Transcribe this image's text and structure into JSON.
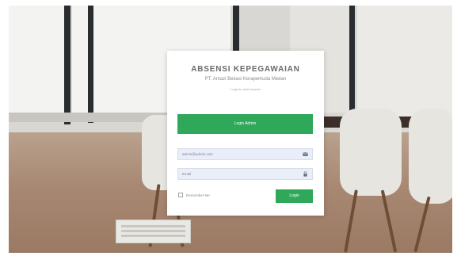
{
  "login": {
    "title": "ABSENSI KEPEGAWAIAN",
    "subtitle": "PT. Amazi Bekasi Kerapemuda Medan",
    "hint": "Login to start session",
    "top_button": "Login Admin",
    "email": {
      "value": "",
      "placeholder": "admin@admin.com"
    },
    "password": {
      "value": "",
      "placeholder": "Email"
    },
    "remember_label": "Remember Me",
    "submit_label": "Login"
  },
  "icons": {
    "email": "envelope-icon",
    "password": "lock-icon"
  },
  "colors": {
    "accent": "#2fa85a",
    "input_bg": "#e9eef9",
    "card_bg": "#ffffff"
  }
}
